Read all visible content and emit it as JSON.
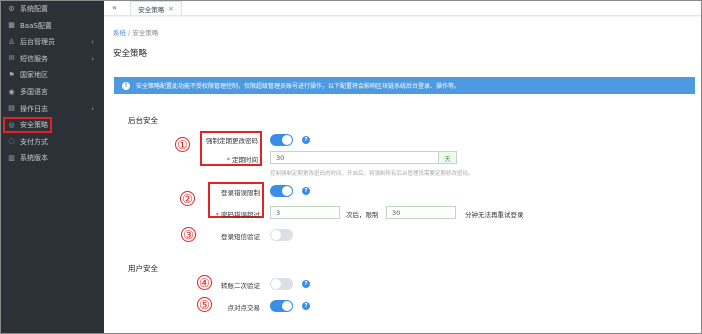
{
  "sidebar": {
    "items": [
      {
        "icon": "gear-icon",
        "glyph": "⚙",
        "label": "系统配置",
        "arrow": ""
      },
      {
        "icon": "cube-icon",
        "glyph": "▦",
        "label": "BaaS配置",
        "arrow": ""
      },
      {
        "icon": "user-icon",
        "glyph": "♙",
        "label": "后台管理员",
        "arrow": "›"
      },
      {
        "icon": "message-icon",
        "glyph": "✉",
        "label": "短信服务",
        "arrow": "›"
      },
      {
        "icon": "flag-icon",
        "glyph": "⚑",
        "label": "国家地区",
        "arrow": ""
      },
      {
        "icon": "globe-icon",
        "glyph": "◉",
        "label": "多国语言",
        "arrow": ""
      },
      {
        "icon": "log-icon",
        "glyph": "▤",
        "label": "操作日志",
        "arrow": "›"
      },
      {
        "icon": "shield-icon",
        "glyph": "◎",
        "label": "安全策略",
        "arrow": ""
      },
      {
        "icon": "pay-icon",
        "glyph": "◌",
        "label": "支付方式",
        "arrow": ""
      },
      {
        "icon": "version-icon",
        "glyph": "▥",
        "label": "系统版本",
        "arrow": ""
      }
    ]
  },
  "topbar": {
    "back": "«",
    "tab_label": "安全策略",
    "tab_close": "✕"
  },
  "breadcrumb": {
    "root": "系统",
    "sep": "/",
    "current": "安全策略"
  },
  "page_title": "安全策略",
  "alert": {
    "icon": "!",
    "text": "安全策略配置此功能不受权限管理控制，仅限超级管理员账号进行操作，以下配置将会影响区块链系统后台登录、操作等。"
  },
  "sections": {
    "backend": "后台安全",
    "user": "用户安全"
  },
  "fields": {
    "force_change": {
      "label": "强制定期更改密码",
      "on": true
    },
    "period": {
      "req": "*",
      "label": "定期时间",
      "value": "30",
      "unit": "天",
      "hint": "控制强制定期更改密码的时间，开启后，将强制所有后台管理员需要定期修改密码。"
    },
    "login_limit": {
      "label": "登录错误限制",
      "on": true
    },
    "pw_errors": {
      "req": "*",
      "label": "密码错误超过",
      "value": "3",
      "mid": "次后，限制",
      "value2": "30",
      "tail": "分钟无法再重试登录"
    },
    "sms_verify": {
      "label": "登录短信验证",
      "on": false
    },
    "two_factor": {
      "label": "转账二次验证",
      "on": false
    },
    "p2p": {
      "label": "点对点交易",
      "on": true
    }
  },
  "markers": [
    "①",
    "②",
    "③",
    "④",
    "⑤"
  ],
  "help_icon": "?",
  "colors": {
    "accent": "#3a8ee6",
    "annotation": "#e02424",
    "sidebar": "#2b3137"
  }
}
